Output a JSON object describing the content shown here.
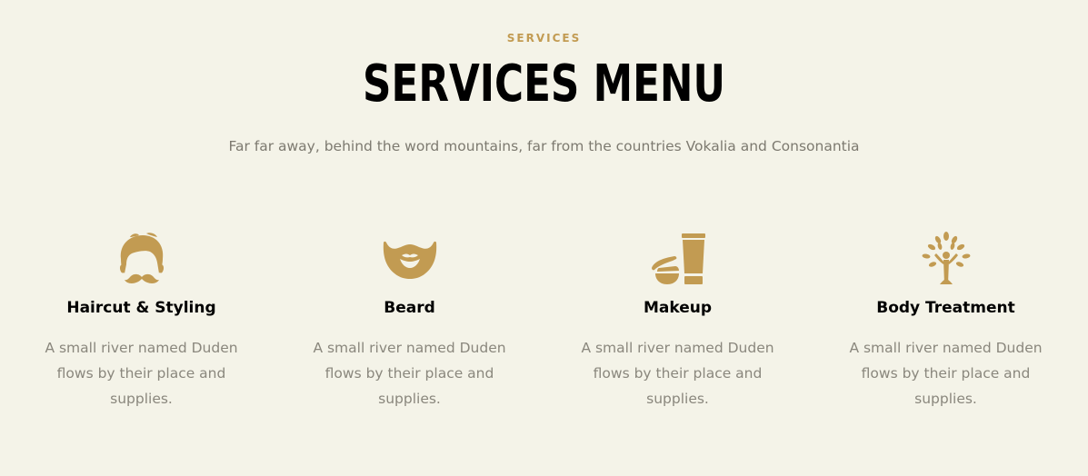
{
  "colors": {
    "background": "#f4f3e8",
    "accent": "#c29b52",
    "heading": "#000000",
    "muted": "#7d7a70"
  },
  "header": {
    "eyebrow": "SERVICES",
    "title": "SERVICES MENU",
    "subtitle": "Far far away, behind the word mountains, far from the countries Vokalia and Consonantia"
  },
  "services": [
    {
      "icon": "hair-mustache-icon",
      "name": "Haircut & Styling",
      "description": "A small river named Duden flows by their place and supplies."
    },
    {
      "icon": "beard-icon",
      "name": "Beard",
      "description": "A small river named Duden flows by their place and supplies."
    },
    {
      "icon": "makeup-icon",
      "name": "Makeup",
      "description": "A small river named Duden flows by their place and supplies."
    },
    {
      "icon": "tree-person-icon",
      "name": "Body Treatment",
      "description": "A small river named Duden flows by their place and supplies."
    }
  ]
}
